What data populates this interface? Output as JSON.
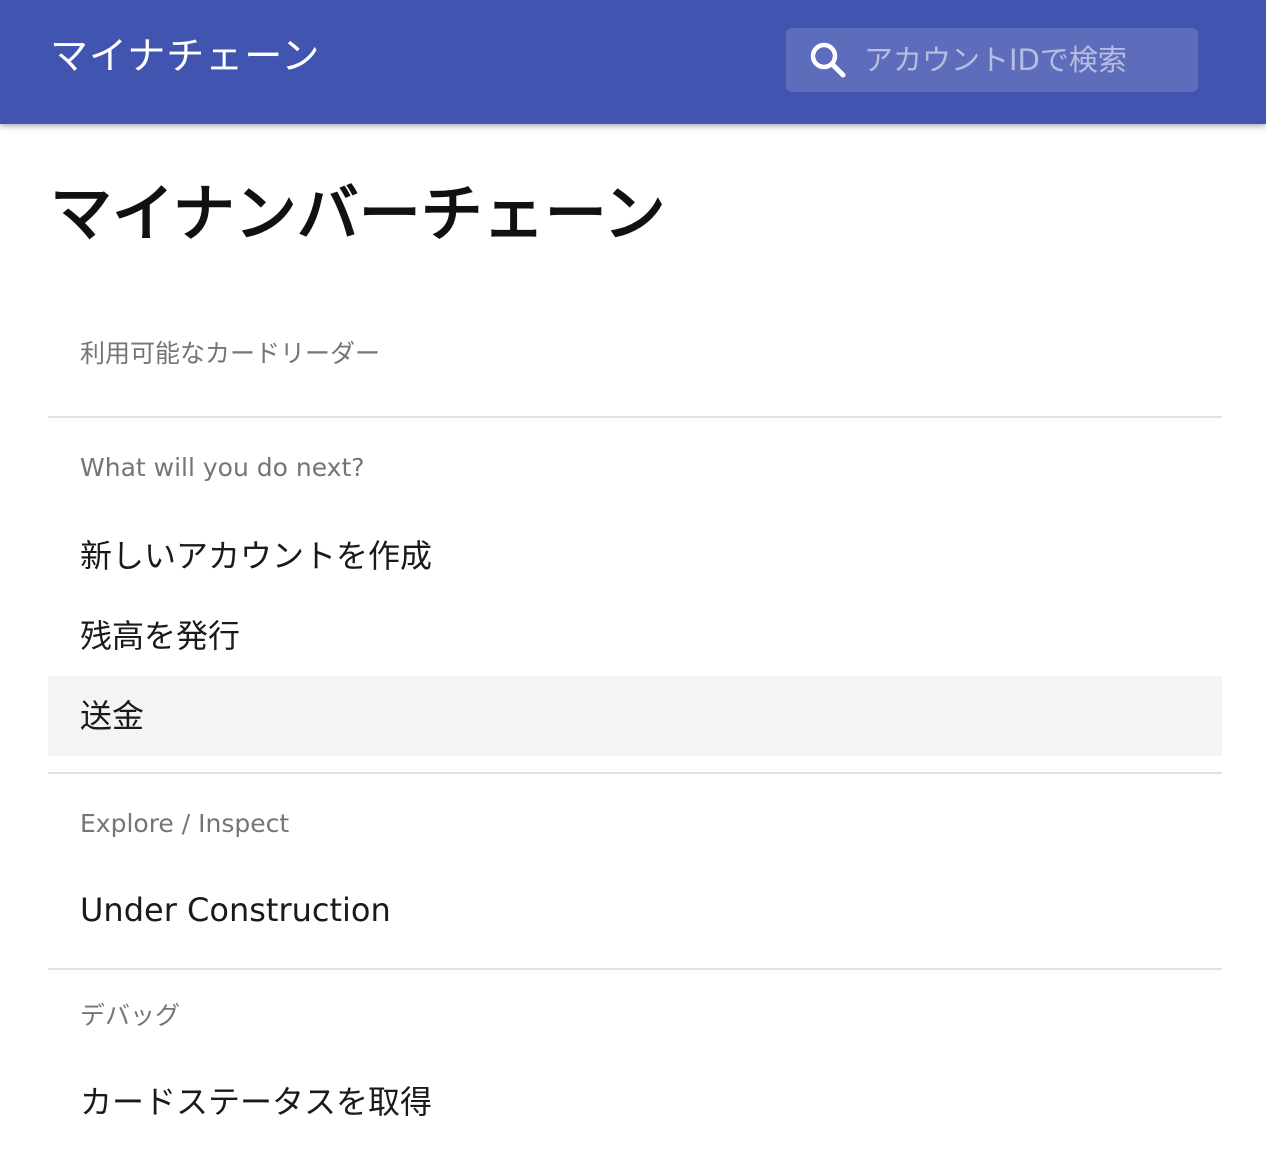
{
  "appbar": {
    "title": "マイナチェーン",
    "search": {
      "placeholder": "アカウントIDで検索",
      "icon": "search-icon"
    },
    "color": "#4154b0"
  },
  "page": {
    "title": "マイナンバーチェーン"
  },
  "sections": [
    {
      "subheader": "利用可能なカードリーダー",
      "items": []
    },
    {
      "subheader": "What will you do next?",
      "items": [
        {
          "label": "新しいアカウントを作成",
          "selected": false
        },
        {
          "label": "残高を発行",
          "selected": false
        },
        {
          "label": "送金",
          "selected": true
        }
      ]
    },
    {
      "subheader": "Explore / Inspect",
      "items": [
        {
          "label": "Under Construction",
          "selected": false
        }
      ]
    },
    {
      "subheader": "デバッグ",
      "items": [
        {
          "label": "カードステータスを取得",
          "selected": false
        }
      ]
    }
  ]
}
